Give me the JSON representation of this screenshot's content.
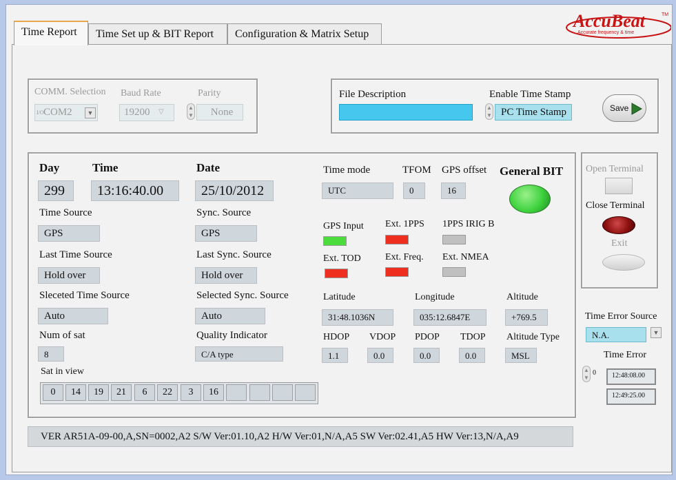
{
  "brand": {
    "name": "AccuBeat",
    "tagline": "Accurate frequency & time",
    "tm": "TM"
  },
  "tabs": [
    {
      "label": "Time Report",
      "active": true
    },
    {
      "label": "Time Set up & BIT Report",
      "active": false
    },
    {
      "label": "Configuration & Matrix Setup",
      "active": false
    }
  ],
  "comm": {
    "selection_label": "COMM. Selection",
    "baud_label": "Baud Rate",
    "parity_label": "Parity",
    "port_prefix": "I/O",
    "port_value": "COM2",
    "baud_value": "19200",
    "parity_value": "None"
  },
  "file": {
    "description_label": "File Description",
    "description_value": "",
    "timestamp_label": "Enable Time Stamp",
    "timestamp_value": "PC Time Stamp",
    "save_label": "Save"
  },
  "main": {
    "day_label": "Day",
    "day_value": "299",
    "time_label": "Time",
    "time_value": "13:16:40.00",
    "date_label": "Date",
    "date_value": "25/10/2012",
    "time_source_label": "Time Source",
    "time_source_value": "GPS",
    "sync_source_label": "Sync. Source",
    "sync_source_value": "GPS",
    "last_time_source_label": "Last Time Source",
    "last_time_source_value": "Hold over",
    "last_sync_source_label": "Last Sync. Source",
    "last_sync_source_value": "Hold over",
    "selected_time_source_label": "Sleceted Time Source",
    "selected_time_source_value": "Auto",
    "selected_sync_source_label": "Selected Sync. Source",
    "selected_sync_source_value": "Auto",
    "num_sat_label": "Num of sat",
    "num_sat_value": "8",
    "quality_label": "Quality Indicator",
    "quality_value": "C/A type",
    "sat_in_view_label": "Sat in view",
    "sat_in_view": [
      "0",
      "14",
      "19",
      "21",
      "6",
      "22",
      "3",
      "16",
      "",
      "",
      "",
      ""
    ],
    "time_mode_label": "Time mode",
    "time_mode_value": "UTC",
    "tfom_label": "TFOM",
    "tfom_value": "0",
    "gps_offset_label": "GPS offset",
    "gps_offset_value": "16",
    "general_bit_label": "General BIT",
    "inputs": [
      {
        "label": "GPS Input",
        "status_color": "#4cdc3c"
      },
      {
        "label": "Ext. 1PPS",
        "status_color": "#ee2e1e"
      },
      {
        "label": "1PPS IRIG B",
        "status_color": "#c0c0c0"
      },
      {
        "label": "Ext. TOD",
        "status_color": "#ee2e1e"
      },
      {
        "label": "Ext. Freq.",
        "status_color": "#ee2e1e"
      },
      {
        "label": "Ext. NMEA",
        "status_color": "#c0c0c0"
      }
    ],
    "latitude_label": "Latitude",
    "latitude_value": "31:48.1036N",
    "longitude_label": "Longitude",
    "longitude_value": "035:12.6847E",
    "altitude_label": "Altitude",
    "altitude_value": "+769.5",
    "hdop_label": "HDOP",
    "hdop_value": "1.1",
    "vdop_label": "VDOP",
    "vdop_value": "0.0",
    "pdop_label": "PDOP",
    "pdop_value": "0.0",
    "tdop_label": "TDOP",
    "tdop_value": "0.0",
    "altitude_type_label": "Altitude Type",
    "altitude_type_value": "MSL"
  },
  "terminal": {
    "open_label": "Open Terminal",
    "close_label": "Close Terminal",
    "exit_label": "Exit"
  },
  "time_error": {
    "source_label": "Time Error Source",
    "source_value": "N.A.",
    "label": "Time Error",
    "spin_value": "0",
    "value1": "12:48:08.00",
    "value2": "12:49:25.00"
  },
  "version": "VER AR51A-09-00,A,SN=0002,A2 S/W Ver:01.10,A2 H/W Ver:01,N/A,A5 SW Ver:02.41,A5 HW Ver:13,N/A,A9",
  "colors": {
    "accent_blue": "#46c8ee",
    "led_green": "#3ed23e",
    "led_red": "#8e1010",
    "brand_red": "#c81414"
  }
}
